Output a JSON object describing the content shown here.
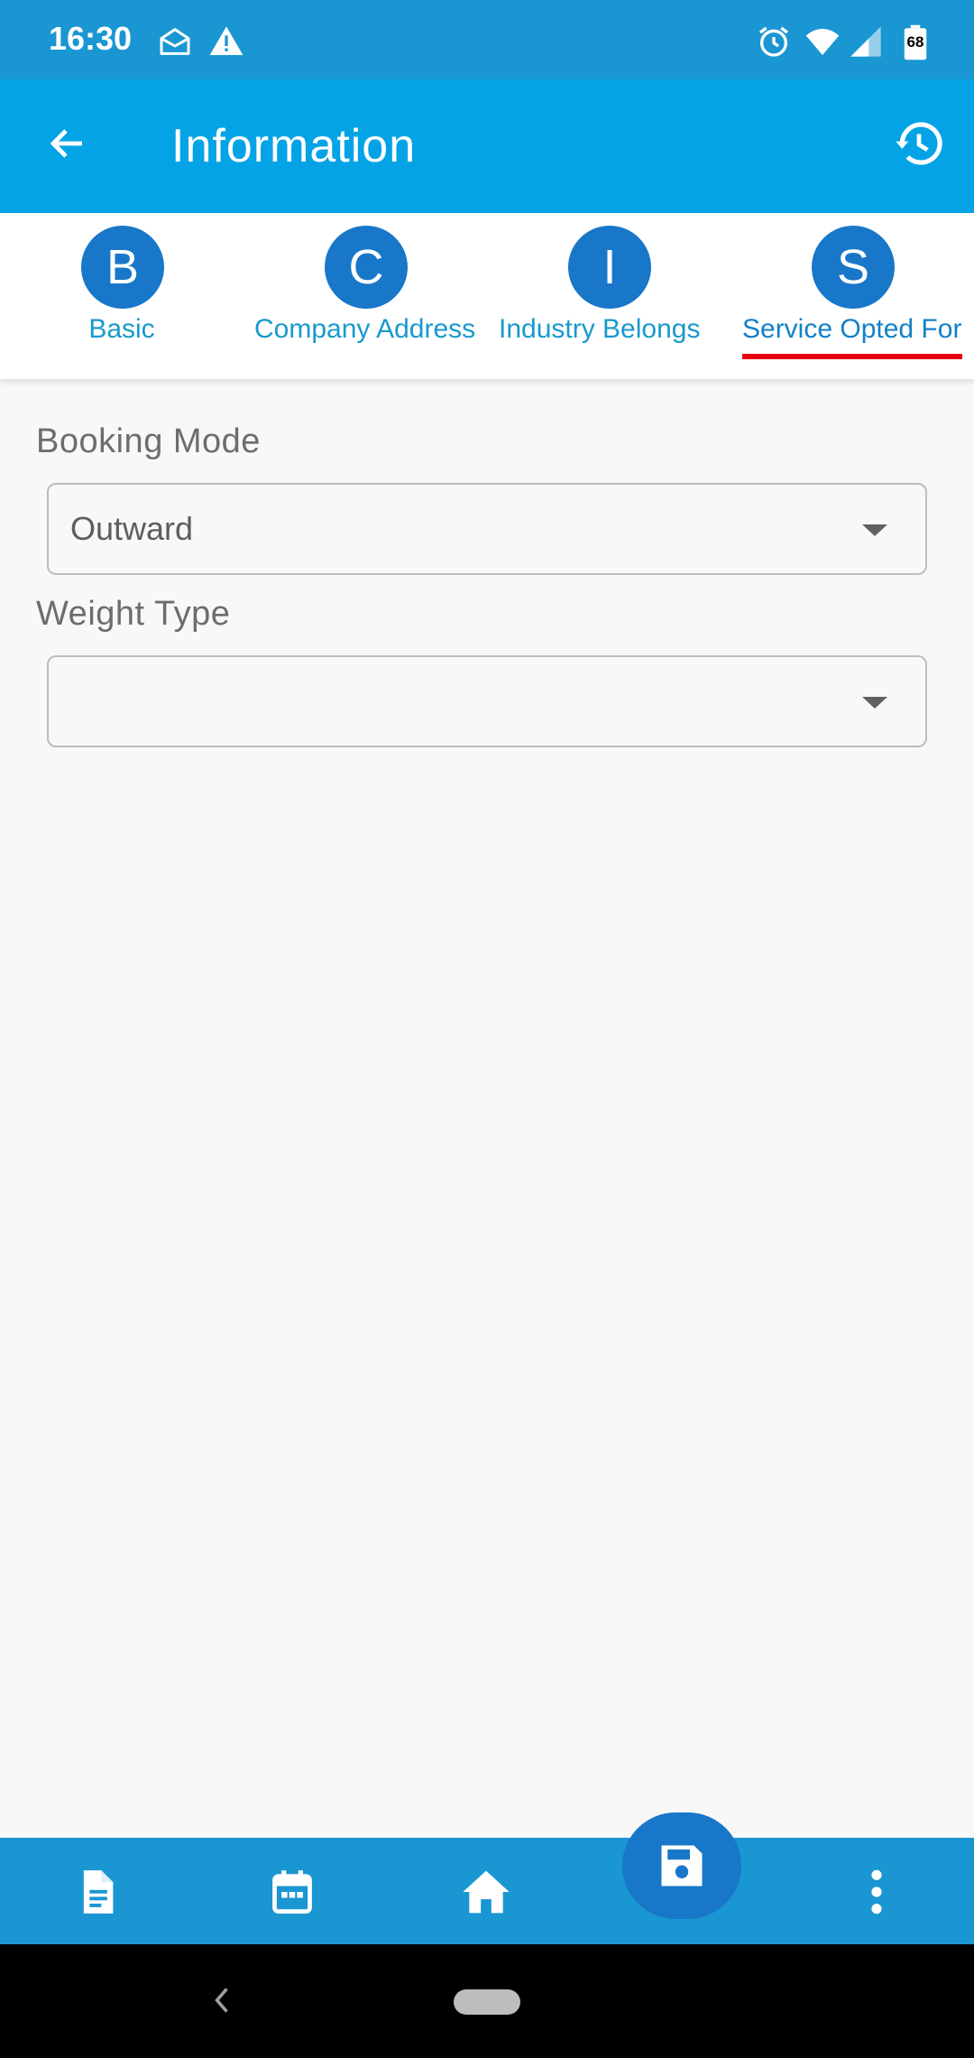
{
  "status_bar": {
    "time": "16:30",
    "battery": "68"
  },
  "app_bar": {
    "title": "Information"
  },
  "tabs": [
    {
      "letter": "B",
      "label": "Basic"
    },
    {
      "letter": "C",
      "label": "Company Address"
    },
    {
      "letter": "I",
      "label": "Industry Belongs"
    },
    {
      "letter": "S",
      "label": "Service Opted For"
    }
  ],
  "form": {
    "booking_mode": {
      "label": "Booking Mode",
      "value": "Outward"
    },
    "weight_type": {
      "label": "Weight Type",
      "value": ""
    }
  },
  "colors": {
    "status_bar": "#1a96d2",
    "app_bar": "#03a3e6",
    "accent": "#1877c9",
    "tab_text": "#1899cc",
    "active_underline": "#e4000f"
  },
  "icons": {
    "status": [
      "mail-open-icon",
      "warning-icon",
      "alarm-icon",
      "wifi-icon",
      "signal-icon",
      "battery-icon"
    ],
    "app_bar": [
      "back-arrow-icon",
      "history-icon"
    ],
    "bottom_nav": [
      "document-icon",
      "calendar-icon",
      "home-icon",
      "save-icon",
      "more-vert-icon"
    ]
  }
}
